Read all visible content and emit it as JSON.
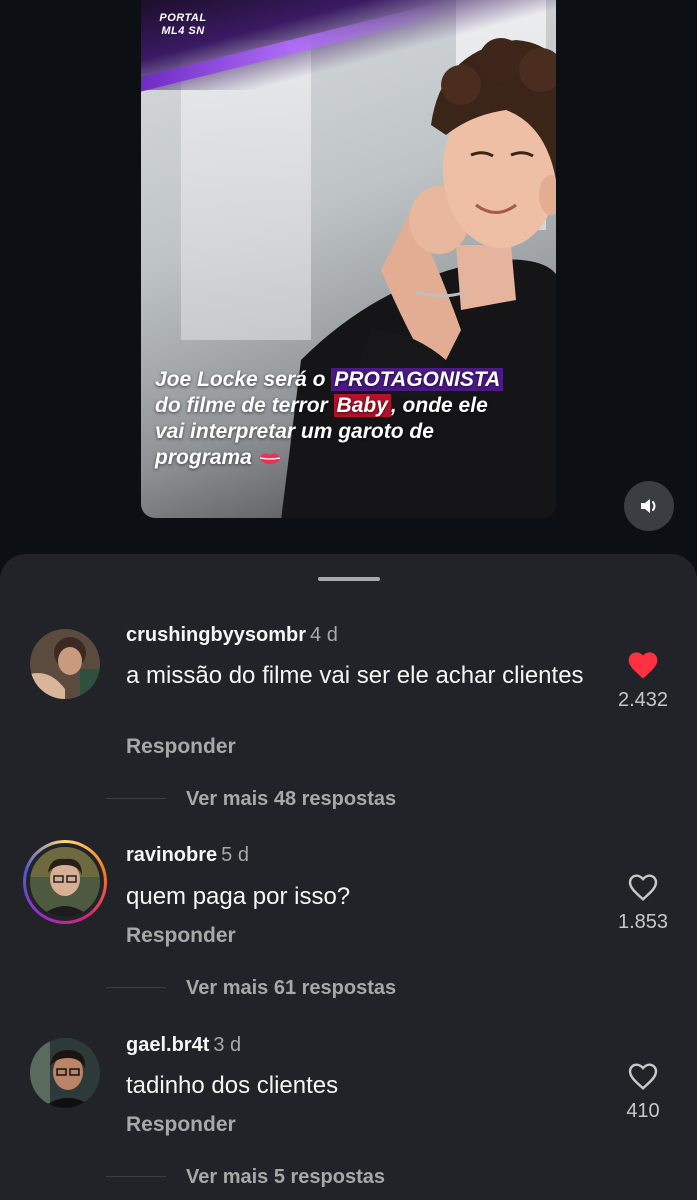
{
  "post": {
    "portal_logo_line1": "PORTAL",
    "portal_logo_line2": "ML4 SN",
    "caption": {
      "part1": "Joe Locke será o ",
      "highlight1": "PROTAGONISTA",
      "part2": " do filme de terror ",
      "highlight2": "Baby",
      "part3": ", onde ele vai interpretar um garoto de programa"
    },
    "mute_icon": "speaker-icon",
    "colors": {
      "highlight_purple": "#4b1a86",
      "highlight_red": "#b3122a"
    }
  },
  "comments": [
    {
      "username": "crushingbyysombr",
      "time": "4 d",
      "text": "a missão do filme vai ser ele achar clientes",
      "reply_label": "Responder",
      "likes": "2.432",
      "liked": true,
      "more_replies": "Ver mais 48 respostas"
    },
    {
      "username": "ravinobre",
      "time": "5 d",
      "text": "quem paga por isso?",
      "reply_label": "Responder",
      "likes": "1.853",
      "liked": false,
      "more_replies": "Ver mais 61 respostas"
    },
    {
      "username": "gael.br4t",
      "time": "3 d",
      "text": "tadinho dos clientes",
      "reply_label": "Responder",
      "likes": "410",
      "liked": false,
      "more_replies": "Ver mais 5 respostas"
    }
  ],
  "colors": {
    "background": "#0c1014",
    "sheet": "#212328",
    "like_active": "#ff3040"
  }
}
